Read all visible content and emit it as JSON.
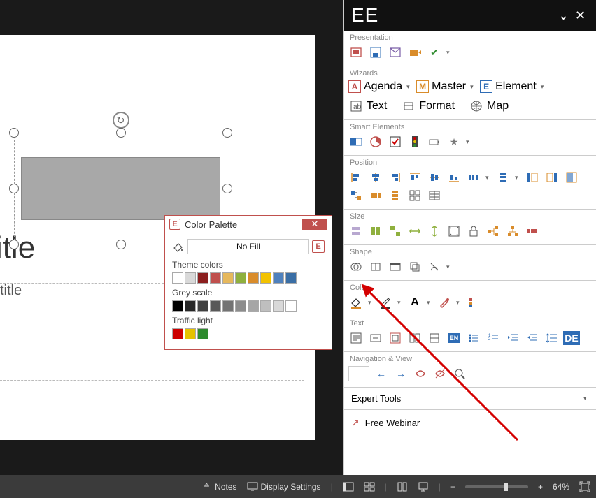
{
  "panel": {
    "brand": "EE",
    "groups": {
      "presentation": "Presentation",
      "wizards": "Wizards",
      "smart": "Smart Elements",
      "position": "Position",
      "size": "Size",
      "shape": "Shape",
      "color": "Color",
      "text": "Text",
      "nav": "Navigation & View"
    },
    "wizard_buttons": {
      "agenda": "Agenda",
      "master": "Master",
      "element": "Element",
      "text": "Text",
      "format": "Format",
      "map": "Map"
    },
    "expert": "Expert Tools",
    "webinar": "Free Webinar"
  },
  "palette": {
    "title": "Color Palette",
    "nofill": "No Fill",
    "theme_label": "Theme colors",
    "grey_label": "Grey scale",
    "traffic_label": "Traffic light",
    "theme_colors": [
      "#ffffff",
      "#d9d9d9",
      "#8c1f1f",
      "#c0504d",
      "#e6b85c",
      "#8fb03e",
      "#d98c2b",
      "#f2c200",
      "#4f81bd",
      "#3a6ea5"
    ],
    "grey_colors": [
      "#000000",
      "#262626",
      "#404040",
      "#595959",
      "#737373",
      "#8c8c8c",
      "#a6a6a6",
      "#bfbfbf",
      "#d9d9d9",
      "#ffffff"
    ],
    "traffic_colors": [
      "#cc0000",
      "#e6c200",
      "#2e8b2e"
    ]
  },
  "slide": {
    "title_placeholder": "d title",
    "subtitle_placeholder": "title"
  },
  "statusbar": {
    "notes": "Notes",
    "display": "Display Settings",
    "zoom_pct": "64%"
  }
}
